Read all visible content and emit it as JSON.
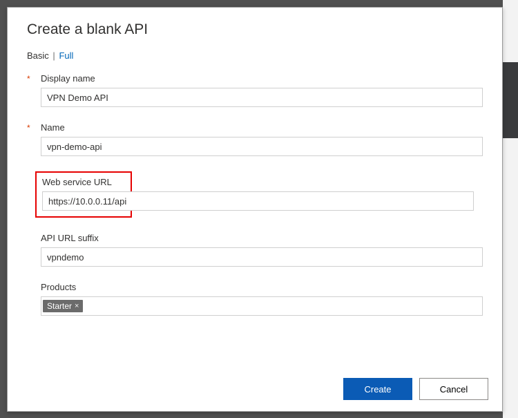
{
  "dialog": {
    "title": "Create a blank API"
  },
  "tabs": {
    "basic": "Basic",
    "separator": "|",
    "full": "Full"
  },
  "fields": {
    "displayName": {
      "label": "Display name",
      "value": "VPN Demo API"
    },
    "name": {
      "label": "Name",
      "value": "vpn-demo-api"
    },
    "webServiceUrl": {
      "label": "Web service URL",
      "value": "https://10.0.0.11/api"
    },
    "apiUrlSuffix": {
      "label": "API URL suffix",
      "value": "vpndemo"
    },
    "products": {
      "label": "Products"
    }
  },
  "productTags": [
    {
      "label": "Starter"
    }
  ],
  "buttons": {
    "create": "Create",
    "cancel": "Cancel"
  }
}
